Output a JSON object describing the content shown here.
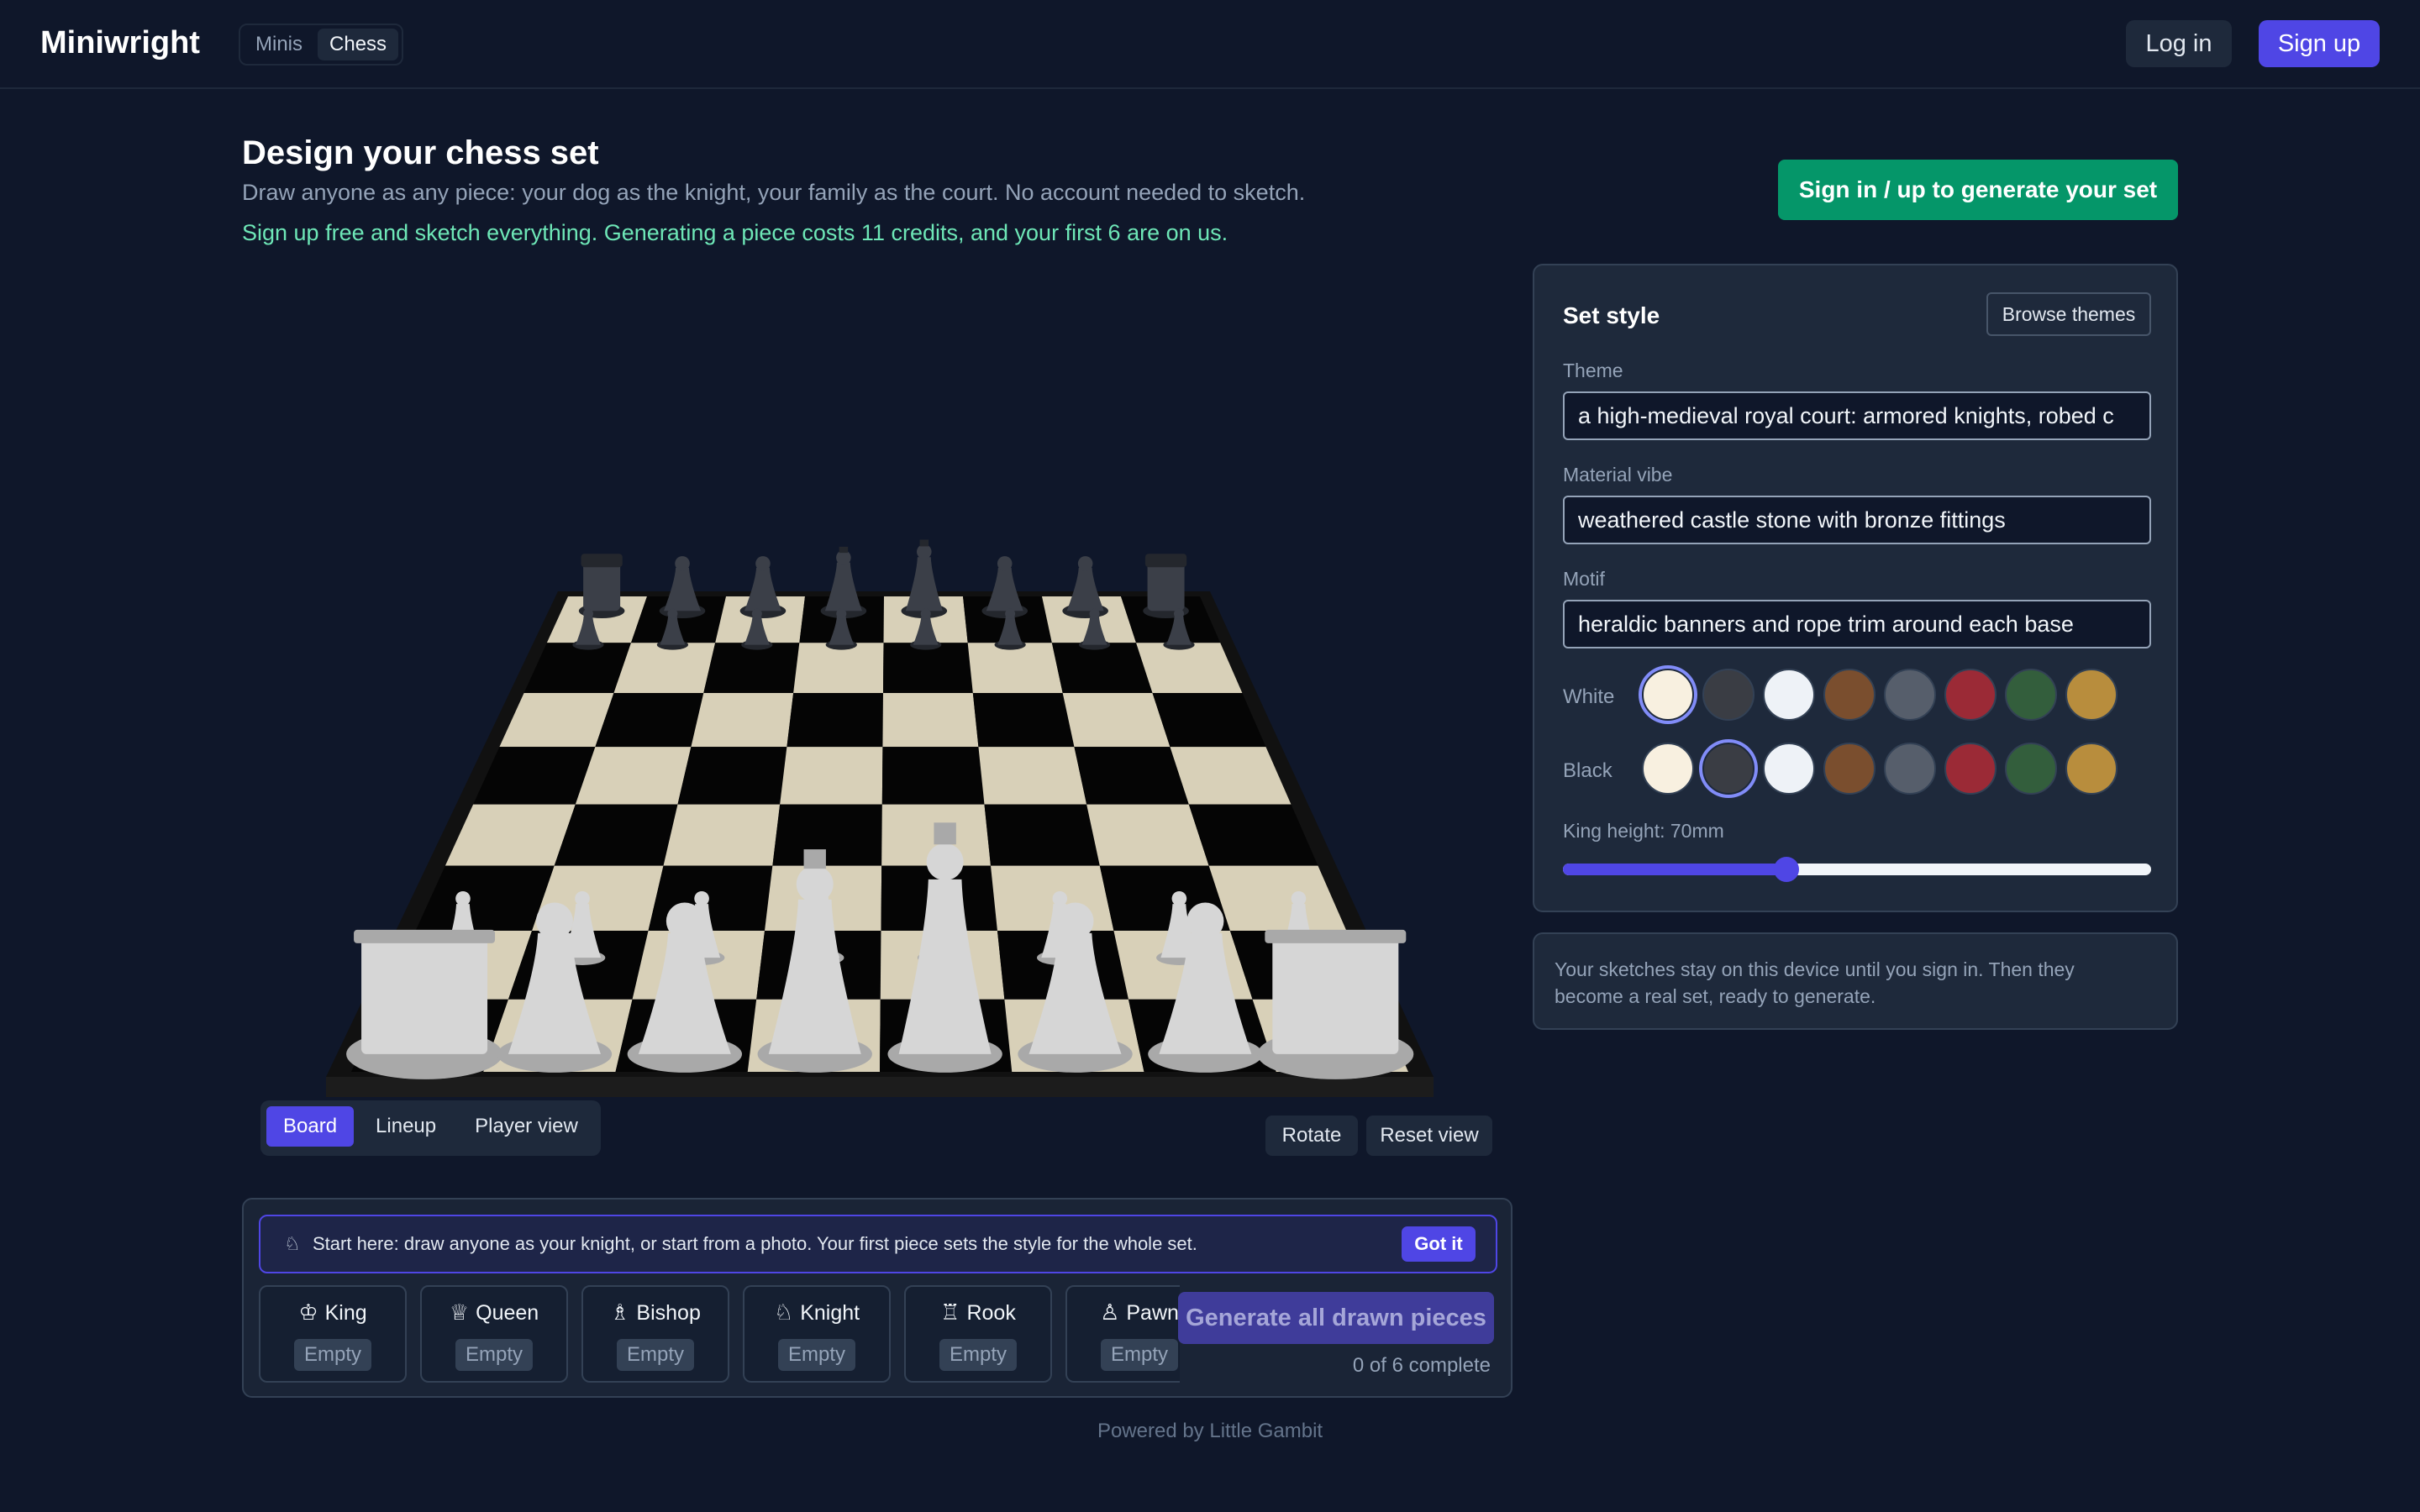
{
  "app": {
    "brand": "Miniwright"
  },
  "nav": {
    "tabs": [
      {
        "label": "Minis"
      },
      {
        "label": "Chess"
      }
    ],
    "active_tab": "Chess",
    "login_label": "Log in",
    "signup_label": "Sign up"
  },
  "header": {
    "title": "Design your chess set",
    "subtitle": "Draw anyone as any piece: your dog as the knight, your family as the court. No account needed to sketch.",
    "promo": "Sign up free and sketch everything. Generating a piece costs 11 credits, and your first 6 are on us.",
    "cta_label": "Sign in / up to generate your set"
  },
  "board": {
    "view_tabs": [
      {
        "label": "Board"
      },
      {
        "label": "Lineup"
      },
      {
        "label": "Player view"
      }
    ],
    "active_view": "Board",
    "rotate_label": "Rotate",
    "reset_label": "Reset view",
    "colors": {
      "light_square": "#d8d0b8",
      "dark_square": "#050505",
      "white_pieces": "#d6d6d6",
      "black_pieces": "#3b3f48"
    }
  },
  "pieces": {
    "hint": {
      "icon": "knight-icon",
      "text": "Start here: draw anyone as your knight, or start from a photo. Your first piece sets the style for the whole set.",
      "dismiss_label": "Got it"
    },
    "slots": [
      {
        "name": "King",
        "glyph": "♔",
        "icon": "king-icon",
        "status": "Empty"
      },
      {
        "name": "Queen",
        "glyph": "♕",
        "icon": "queen-icon",
        "status": "Empty"
      },
      {
        "name": "Bishop",
        "glyph": "♗",
        "icon": "bishop-icon",
        "status": "Empty"
      },
      {
        "name": "Knight",
        "glyph": "♘",
        "icon": "knight-icon",
        "status": "Empty"
      },
      {
        "name": "Rook",
        "glyph": "♖",
        "icon": "rook-icon",
        "status": "Empty"
      },
      {
        "name": "Pawn",
        "glyph": "♙",
        "icon": "pawn-icon",
        "status": "Empty"
      }
    ],
    "generate_all_label": "Generate all drawn pieces",
    "progress_text": "0 of 6 complete"
  },
  "style": {
    "title": "Set style",
    "browse_label": "Browse themes",
    "theme": {
      "label": "Theme",
      "value": "a high-medieval royal court: armored knights, robed c"
    },
    "material": {
      "label": "Material vibe",
      "value": "weathered castle stone with bronze fittings"
    },
    "motif": {
      "label": "Motif",
      "value": "heraldic banners and rope trim around each base"
    },
    "swatch_colors": [
      "#f8f0e0",
      "#3a3d44",
      "#eef2f7",
      "#7a4e2e",
      "#565e6b",
      "#9b2a36",
      "#335e3c",
      "#b88d3d"
    ],
    "white": {
      "label": "White",
      "selected_index": 0
    },
    "black": {
      "label": "Black",
      "selected_index": 1
    },
    "king_height": {
      "label": "King height: 70mm",
      "fraction": 0.38
    }
  },
  "note": {
    "text": "Your sketches stay on this device until you sign in. Then they become a real set, ready to generate."
  },
  "footer": {
    "text": "Powered by Little Gambit"
  }
}
